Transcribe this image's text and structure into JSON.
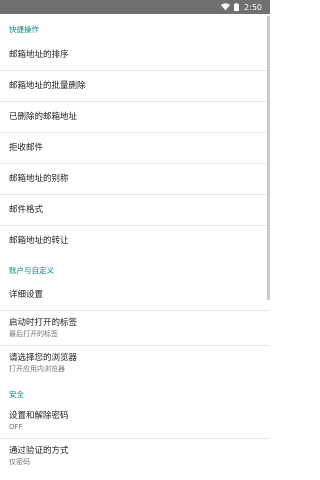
{
  "status_bar": {
    "time": "2:50",
    "icons": [
      "wifi-icon",
      "battery-icon"
    ]
  },
  "sections": [
    {
      "header": "快捷操作",
      "items": [
        {
          "title": "邮箱地址的排序"
        },
        {
          "title": "邮箱地址的批量删除"
        },
        {
          "title": "已删除的邮箱地址"
        },
        {
          "title": "拒收邮件"
        },
        {
          "title": "邮箱地址的别称"
        },
        {
          "title": "邮件格式"
        },
        {
          "title": "邮箱地址的转让"
        }
      ]
    },
    {
      "header": "账户与自定义",
      "items": [
        {
          "title": "详细设置"
        },
        {
          "title": "启动时打开的标签",
          "summary": "最后打开的标签"
        },
        {
          "title": "请选择您的浏览器",
          "summary": "打开应用内浏览器"
        }
      ]
    },
    {
      "header": "安全",
      "items": [
        {
          "title": "设置和解除密码",
          "summary": "OFF"
        },
        {
          "title": "通过验证的方式",
          "summary": "仅密码"
        }
      ]
    }
  ]
}
